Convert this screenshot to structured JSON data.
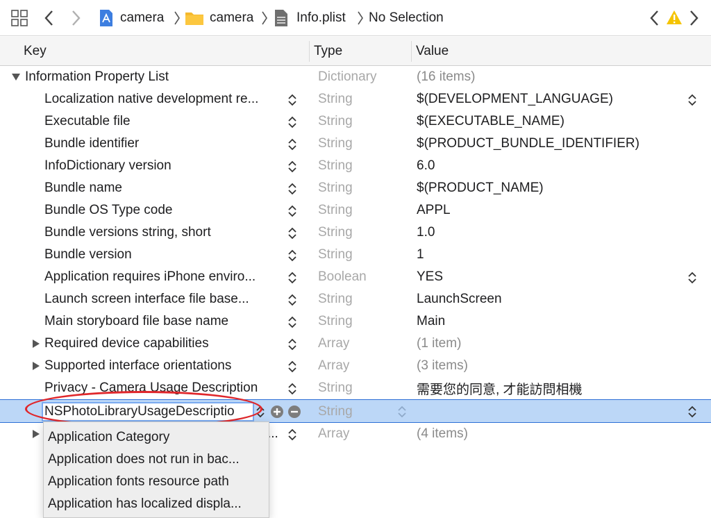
{
  "jumpbar": {
    "crumbs": [
      "camera",
      "camera",
      "Info.plist",
      "No Selection"
    ],
    "icons": [
      "related-items-icon",
      "back-arrow-icon",
      "forward-arrow-icon",
      "project-icon",
      "folder-icon",
      "plist-file-icon",
      "warning-icon"
    ]
  },
  "header": {
    "key": "Key",
    "type": "Type",
    "value": "Value"
  },
  "root": {
    "key": "Information Property List",
    "type": "Dictionary",
    "value": "(16 items)"
  },
  "rows": [
    {
      "key": "Localization native development re...",
      "type": "String",
      "value": "$(DEVELOPMENT_LANGUAGE)",
      "value_popup": true
    },
    {
      "key": "Executable file",
      "type": "String",
      "value": "$(EXECUTABLE_NAME)"
    },
    {
      "key": "Bundle identifier",
      "type": "String",
      "value": "$(PRODUCT_BUNDLE_IDENTIFIER)"
    },
    {
      "key": "InfoDictionary version",
      "type": "String",
      "value": "6.0"
    },
    {
      "key": "Bundle name",
      "type": "String",
      "value": "$(PRODUCT_NAME)"
    },
    {
      "key": "Bundle OS Type code",
      "type": "String",
      "value": "APPL"
    },
    {
      "key": "Bundle versions string, short",
      "type": "String",
      "value": "1.0"
    },
    {
      "key": "Bundle version",
      "type": "String",
      "value": "1"
    },
    {
      "key": "Application requires iPhone enviro...",
      "type": "Boolean",
      "value": "YES",
      "value_popup": true
    },
    {
      "key": "Launch screen interface file base...",
      "type": "String",
      "value": "LaunchScreen"
    },
    {
      "key": "Main storyboard file base name",
      "type": "String",
      "value": "Main"
    },
    {
      "key": "Required device capabilities",
      "type": "Array",
      "value": "(1 item)",
      "disclosure": true
    },
    {
      "key": "Supported interface orientations",
      "type": "Array",
      "value": "(3 items)",
      "disclosure": true
    },
    {
      "key": "Privacy - Camera Usage Description",
      "type": "String",
      "value": "需要您的同意, 才能訪問相機"
    }
  ],
  "editing_row": {
    "key": "NSPhotoLibraryUsageDescriptio",
    "type": "String",
    "value": ""
  },
  "last_row": {
    "key": "...",
    "type": "Array",
    "value": "(4 items)"
  },
  "dropdown": [
    "Application Category",
    "Application does not run in bac...",
    "Application fonts resource path",
    "Application has localized displa..."
  ],
  "colors": {
    "selection": "#bcd7f7",
    "selection_border": "#2d6fd6",
    "annotation": "#e0272b",
    "warning": "#f5c400"
  }
}
